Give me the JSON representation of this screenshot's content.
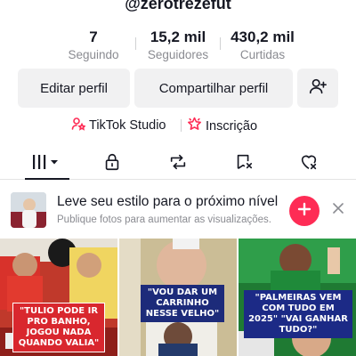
{
  "profile": {
    "username": "@zerotrezefut"
  },
  "stats": [
    {
      "value": "7",
      "label": "Seguindo"
    },
    {
      "value": "15,2 mil",
      "label": "Seguidores"
    },
    {
      "value": "430,2 mil",
      "label": "Curtidas"
    }
  ],
  "actions": {
    "edit_label": "Editar perfil",
    "share_label": "Compartilhar perfil",
    "add_friend_icon": "person-plus-icon"
  },
  "links": {
    "studio_label": "TikTok Studio",
    "subscription_label": "Inscrição"
  },
  "tabs": [
    {
      "name": "videos-grid",
      "icon": "grid-icon",
      "active": true
    },
    {
      "name": "private",
      "icon": "lock-icon"
    },
    {
      "name": "reposts",
      "icon": "repost-icon"
    },
    {
      "name": "favorites",
      "icon": "bookmark-icon"
    },
    {
      "name": "liked",
      "icon": "heart-icon"
    }
  ],
  "promo": {
    "title": "Leve seu estilo para o próximo nível",
    "subtitle": "Publique fotos para aumentar as visualizações."
  },
  "videos": [
    {
      "caption": "\"TULIO PODE IR PRO BANHO, JOGOU NADA QUANDO VALIA\""
    },
    {
      "caption": "\"VOU DAR UM CARRINHO NESSE VELHO\""
    },
    {
      "caption": "\"PALMEIRAS VEM COM TUDO EM 2025\" \"VAI GANHAR TUDO?\""
    }
  ],
  "colors": {
    "accent": "#fe2c55",
    "text": "#161823",
    "muted": "#8a8b91",
    "button_bg": "#f1f1f2"
  }
}
